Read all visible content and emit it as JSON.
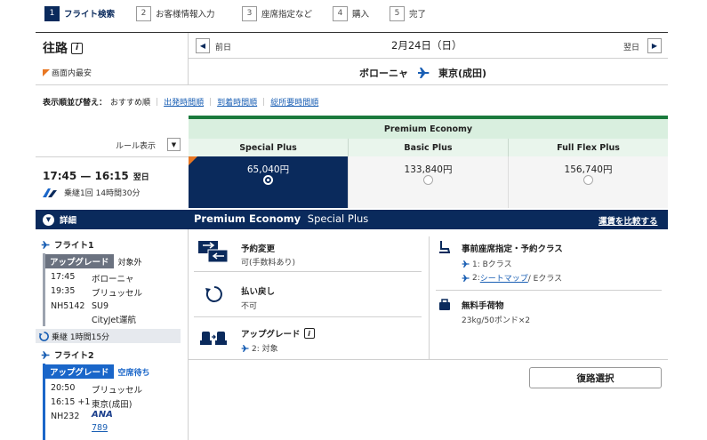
{
  "stepper": [
    {
      "num": "1",
      "label": "フライト検索"
    },
    {
      "num": "2",
      "label": "お客様情報入力"
    },
    {
      "num": "3",
      "label": "座席指定など"
    },
    {
      "num": "4",
      "label": "購入"
    },
    {
      "num": "5",
      "label": "完了"
    }
  ],
  "header": {
    "outbound": "往路",
    "info_icon": "i",
    "lowest_label": "画面内最安",
    "prev_day": "前日",
    "date": "2月24日（日）",
    "next_day": "翌日",
    "origin": "ボローニャ",
    "destination": "東京(成田)"
  },
  "sort": {
    "label": "表示順並び替え：",
    "options": [
      "おすすめ順",
      "出発時間順",
      "到着時間順",
      "総所要時間順"
    ]
  },
  "rules": {
    "label": "ルール表示"
  },
  "cabin": "Premium Economy",
  "fares": [
    {
      "name": "Special Plus",
      "price": "65,040円"
    },
    {
      "name": "Basic Plus",
      "price": "133,840円"
    },
    {
      "name": "Full Flex Plus",
      "price": "156,740円"
    }
  ],
  "itinerary": {
    "times": "17:45 — 16:15",
    "next_day": "翌日",
    "connections": "乗継1回 14時間30分"
  },
  "detail": {
    "toggle": "詳細",
    "title_bold": "Premium Economy",
    "title_rest": "Special Plus",
    "compare": "運賃を比較する"
  },
  "flight1": {
    "label": "フライト1",
    "upgrade": "アップグレード",
    "upgrade_status": "対象外",
    "dep_time": "17:45",
    "dep_city": "ボローニャ",
    "arr_time": "19:35",
    "arr_city": "ブリュッセル",
    "flight_no": "NH5142",
    "equipment": "SU9",
    "operator": "CityJet運航"
  },
  "connection": {
    "text": "乗継 1時間15分"
  },
  "flight2": {
    "label": "フライト2",
    "upgrade": "アップグレード",
    "upgrade_status": "空席待ち",
    "dep_time": "20:50",
    "dep_city": "ブリュッセル",
    "arr_time": "16:15 +1",
    "arr_city": "東京(成田)",
    "flight_no": "NH232",
    "airline": "ANA",
    "equipment": "789"
  },
  "services": {
    "change": {
      "title": "予約変更",
      "value": "可(手数料あり)"
    },
    "refund": {
      "title": "払い戻し",
      "value": "不可"
    },
    "upgrade": {
      "title": "アップグレード",
      "value": "2: 対象"
    },
    "seat": {
      "title": "事前座席指定・予約クラス",
      "line1": "1: Bクラス",
      "line2_prefix": "2: ",
      "line2_link": "シートマップ",
      "line2_suffix": " / Eクラス"
    },
    "baggage": {
      "title": "無料手荷物",
      "value": "23kg/50ポンド×2"
    }
  },
  "return_button": "復路選択",
  "colors": {
    "navy": "#0a2a5c",
    "green": "#1a7a3c",
    "link": "#1a5fb4",
    "orange": "#e87722",
    "mint": "#e9f5ec"
  }
}
